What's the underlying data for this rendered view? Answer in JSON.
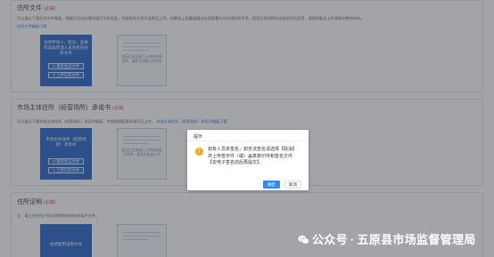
{
  "sections": {
    "s1": {
      "title": "住所文件",
      "required": "(必填)",
      "desc": "可以通过下载住所文件模板，根据公司实际情况填写住所信息，并由相关方签字盖章后上传，如需线上签署请通过在线签署方式办理相关手续，提交后系统将自动校验住所信息，请按照要求上传清晰完整的材料。",
      "link": "住所文件模板下载",
      "card_text": "住所申请人、股东、监事和高级管理人员签名的住所文件",
      "btn_new": "重新生成文件",
      "btn_upload": "上传已有文件",
      "sample_text": "暂无已生成或已上传的住所文件，请先生成或上传文件"
    },
    "s2": {
      "title": "市场主体住所（经营场所）承诺书",
      "required": "(必填)",
      "desc": "可以通过下载市场主体住所（经营场所）承诺书模板，并按照模板要求填写后上传。",
      "link": "市场主体住所（经营场所）承诺书模板下载",
      "card_text": "市场主体住所（经营场所）承诺书",
      "btn_new": "重新生成文件",
      "btn_upload": "上传已有文件",
      "sample_text": "暂无已生成或已上传的承诺书文件，请先生成或上传"
    },
    "s3": {
      "title": "住所证明",
      "required": "(必填)",
      "desc": "注：请上传住所产权证明等相关材料的电子文件。",
      "card_text": "住所使用证明文件"
    }
  },
  "dialog": {
    "title": "提示",
    "icon": "warning-icon",
    "message": "如有人员未签名，如无法签名请选择【取消】并上传签字件（或）盖章复印件和签名文件【去电子签名前后再提交】。",
    "ok_label": "确定",
    "cancel_label": "取消"
  },
  "watermark": {
    "prefix": "公众号",
    "sep": "·",
    "name": "五原县市场监督管理局"
  },
  "colors": {
    "accent": "#1f5fc9",
    "required": "#e4393c",
    "link": "#2d6cdf",
    "warning": "#f5a623",
    "primary_button": "#2d8cf0"
  }
}
